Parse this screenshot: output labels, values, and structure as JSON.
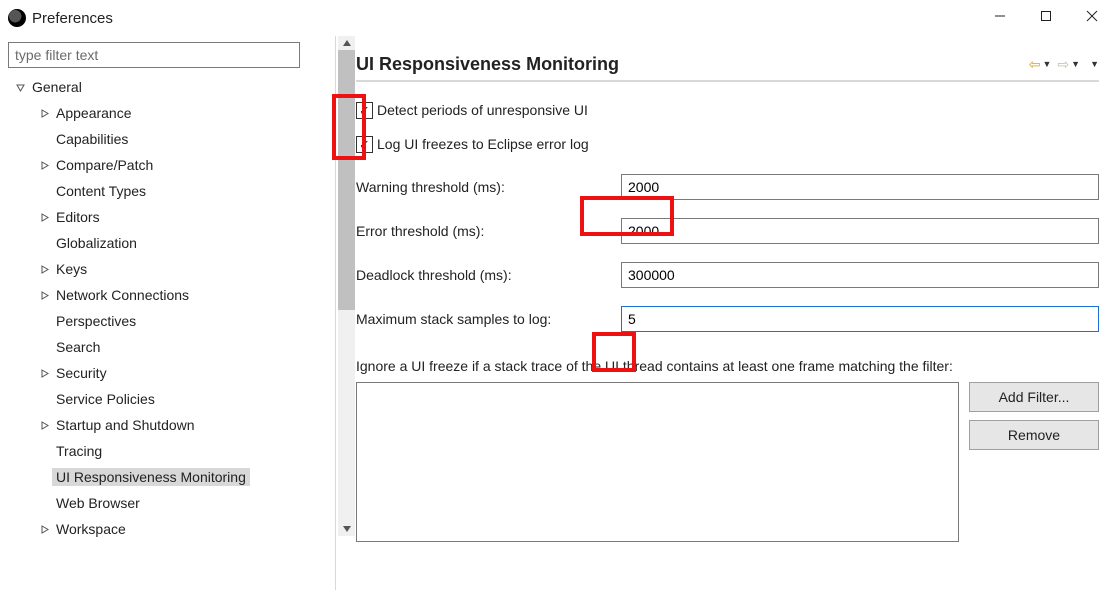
{
  "window": {
    "title": "Preferences"
  },
  "sidebar": {
    "filter_placeholder": "type filter text",
    "nodes": [
      {
        "label": "General",
        "depth": 0,
        "expandable": true,
        "expanded": true
      },
      {
        "label": "Appearance",
        "depth": 1,
        "expandable": true,
        "expanded": false
      },
      {
        "label": "Capabilities",
        "depth": 1,
        "expandable": false
      },
      {
        "label": "Compare/Patch",
        "depth": 1,
        "expandable": true,
        "expanded": false
      },
      {
        "label": "Content Types",
        "depth": 1,
        "expandable": false
      },
      {
        "label": "Editors",
        "depth": 1,
        "expandable": true,
        "expanded": false
      },
      {
        "label": "Globalization",
        "depth": 1,
        "expandable": false
      },
      {
        "label": "Keys",
        "depth": 1,
        "expandable": true,
        "expanded": false
      },
      {
        "label": "Network Connections",
        "depth": 1,
        "expandable": true,
        "expanded": false
      },
      {
        "label": "Perspectives",
        "depth": 1,
        "expandable": false
      },
      {
        "label": "Search",
        "depth": 1,
        "expandable": false
      },
      {
        "label": "Security",
        "depth": 1,
        "expandable": true,
        "expanded": false
      },
      {
        "label": "Service Policies",
        "depth": 1,
        "expandable": false
      },
      {
        "label": "Startup and Shutdown",
        "depth": 1,
        "expandable": true,
        "expanded": false
      },
      {
        "label": "Tracing",
        "depth": 1,
        "expandable": false
      },
      {
        "label": "UI Responsiveness Monitoring",
        "depth": 1,
        "expandable": false,
        "selected": true
      },
      {
        "label": "Web Browser",
        "depth": 1,
        "expandable": false
      },
      {
        "label": "Workspace",
        "depth": 1,
        "expandable": true,
        "expanded": false
      }
    ]
  },
  "main": {
    "title": "UI Responsiveness Monitoring",
    "check_detect": "Detect periods of unresponsive UI",
    "check_log": "Log UI freezes to Eclipse error log",
    "warning_label": "Warning threshold (ms):",
    "warning_value": "2000",
    "error_label": "Error threshold (ms):",
    "error_value": "2000",
    "deadlock_label": "Deadlock threshold (ms):",
    "deadlock_value": "300000",
    "maxstack_label": "Maximum stack samples to log:",
    "maxstack_value": "5",
    "filter_label": "Ignore a UI freeze if a stack trace of the UI thread contains at least one frame matching the filter:",
    "add_filter": "Add Filter...",
    "remove": "Remove"
  }
}
